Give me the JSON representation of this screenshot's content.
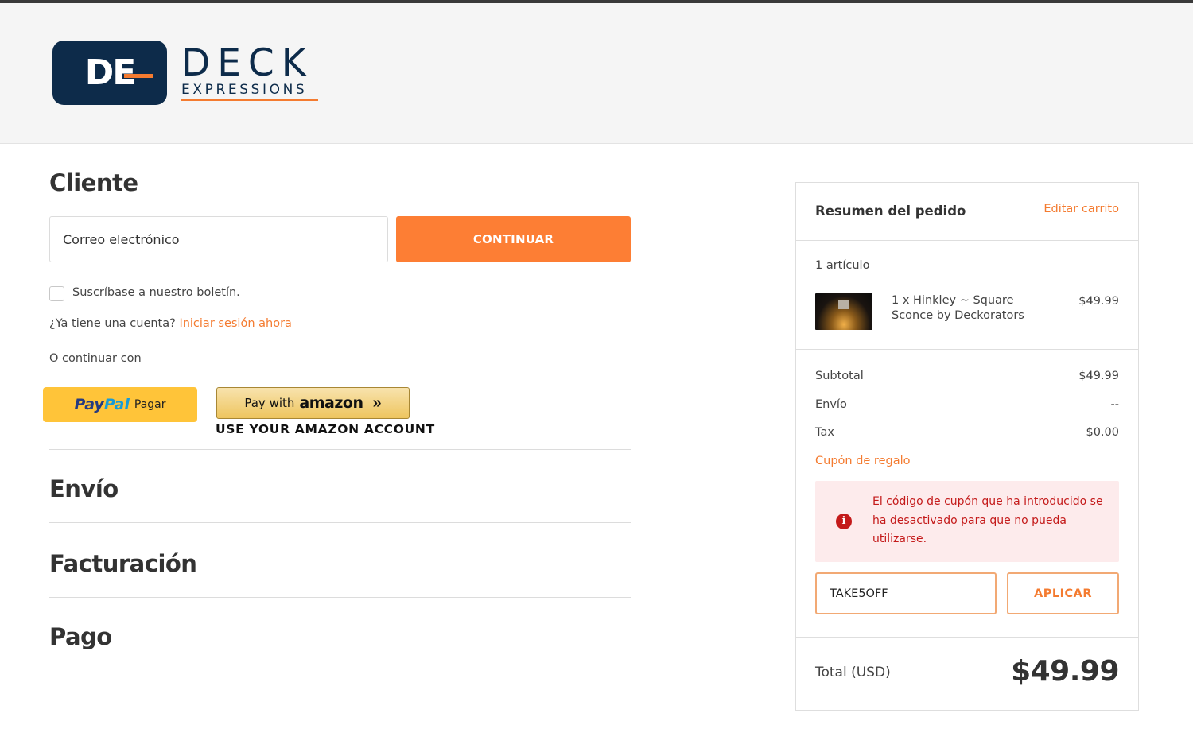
{
  "colors": {
    "accent": "#fd7e34",
    "brand_navy": "#0d2b4a",
    "error": "#c41a1a",
    "paypal_yellow": "#ffc439"
  },
  "logo": {
    "monogram": "DE",
    "name": "DECK",
    "tagline": "EXPRESSIONS"
  },
  "customer": {
    "title": "Cliente",
    "email_placeholder": "Correo electrónico",
    "continue_label": "CONTINUAR",
    "newsletter_label": "Suscríbase a nuestro boletín.",
    "account_prompt": "¿Ya tiene una cuenta?",
    "signin_link": "Iniciar sesión ahora",
    "or_continue": "O continuar con",
    "paypal": {
      "brand_pay": "Pay",
      "brand_pal": "Pal",
      "label": "Pagar"
    },
    "amazon": {
      "prefix": "Pay with",
      "brand": "amazon",
      "caption": "USE YOUR AMAZON ACCOUNT"
    }
  },
  "sections": {
    "shipping": "Envío",
    "billing": "Facturación",
    "payment": "Pago"
  },
  "summary": {
    "title": "Resumen del pedido",
    "edit_link": "Editar carrito",
    "item_count": "1 artículo",
    "item": {
      "name": "1 x Hinkley ~ Square Sconce by Deckorators",
      "price": "$49.99"
    },
    "rows": [
      {
        "label": "Subtotal",
        "value": "$49.99"
      },
      {
        "label": "Envío",
        "value": "--"
      },
      {
        "label": "Tax",
        "value": "$0.00"
      }
    ],
    "gift_link": "Cupón de regalo",
    "error_icon": "i",
    "error_message": "El código de cupón que ha introducido se ha desactivado para que no pueda utilizarse.",
    "coupon_value": "TAKE5OFF",
    "apply_label": "APLICAR",
    "total_label": "Total (USD)",
    "total_value": "$49.99"
  }
}
